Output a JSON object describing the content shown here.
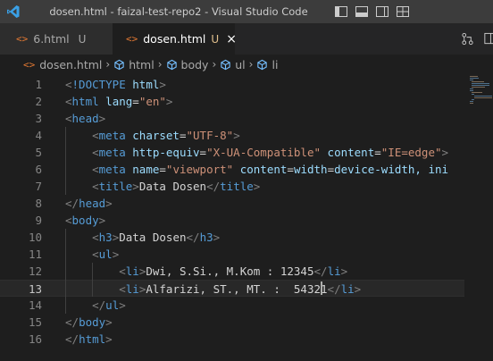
{
  "window": {
    "title": "dosen.html - faizal-test-repo2 - Visual Studio Code"
  },
  "tabs": [
    {
      "icon": "<>",
      "label": "6.html",
      "status": "U",
      "active": false
    },
    {
      "icon": "<>",
      "label": "dosen.html",
      "status": "U",
      "close": "×",
      "active": true
    }
  ],
  "breadcrumb": {
    "file_icon": "<>",
    "file": "dosen.html",
    "separator": "›",
    "nodes": [
      "html",
      "body",
      "ul",
      "li"
    ]
  },
  "editor": {
    "current_line": 13,
    "line_numbers": [
      "1",
      "2",
      "3",
      "4",
      "5",
      "6",
      "7",
      "8",
      "9",
      "10",
      "11",
      "12",
      "13",
      "14",
      "15",
      "16"
    ],
    "lines": [
      "<!DOCTYPE html>",
      "<html lang=\"en\">",
      "<head>",
      "    <meta charset=\"UTF-8\">",
      "    <meta http-equiv=\"X-UA-Compatible\" content=\"IE=edge\">",
      "    <meta name=\"viewport\" content=\"width=device-width, ini",
      "    <title>Data Dosen</title>",
      "</head>",
      "<body>",
      "    <h3>Data Dosen</h3>",
      "    <ul>",
      "        <li>Dwi, S.Si., M.Kom : 12345</li>",
      "        <li>Alfarizi, ST., MT. :  54321</li>",
      "    </ul>",
      "</body>",
      "</html>"
    ]
  },
  "colors": {
    "tag": "#569cd6",
    "attribute": "#9cdcfe",
    "string": "#ce9178",
    "text": "#d4d4d4",
    "punctuation": "#808080",
    "line_number": "#858585",
    "untracked": "#e2c08d",
    "html_icon": "#e37933"
  }
}
